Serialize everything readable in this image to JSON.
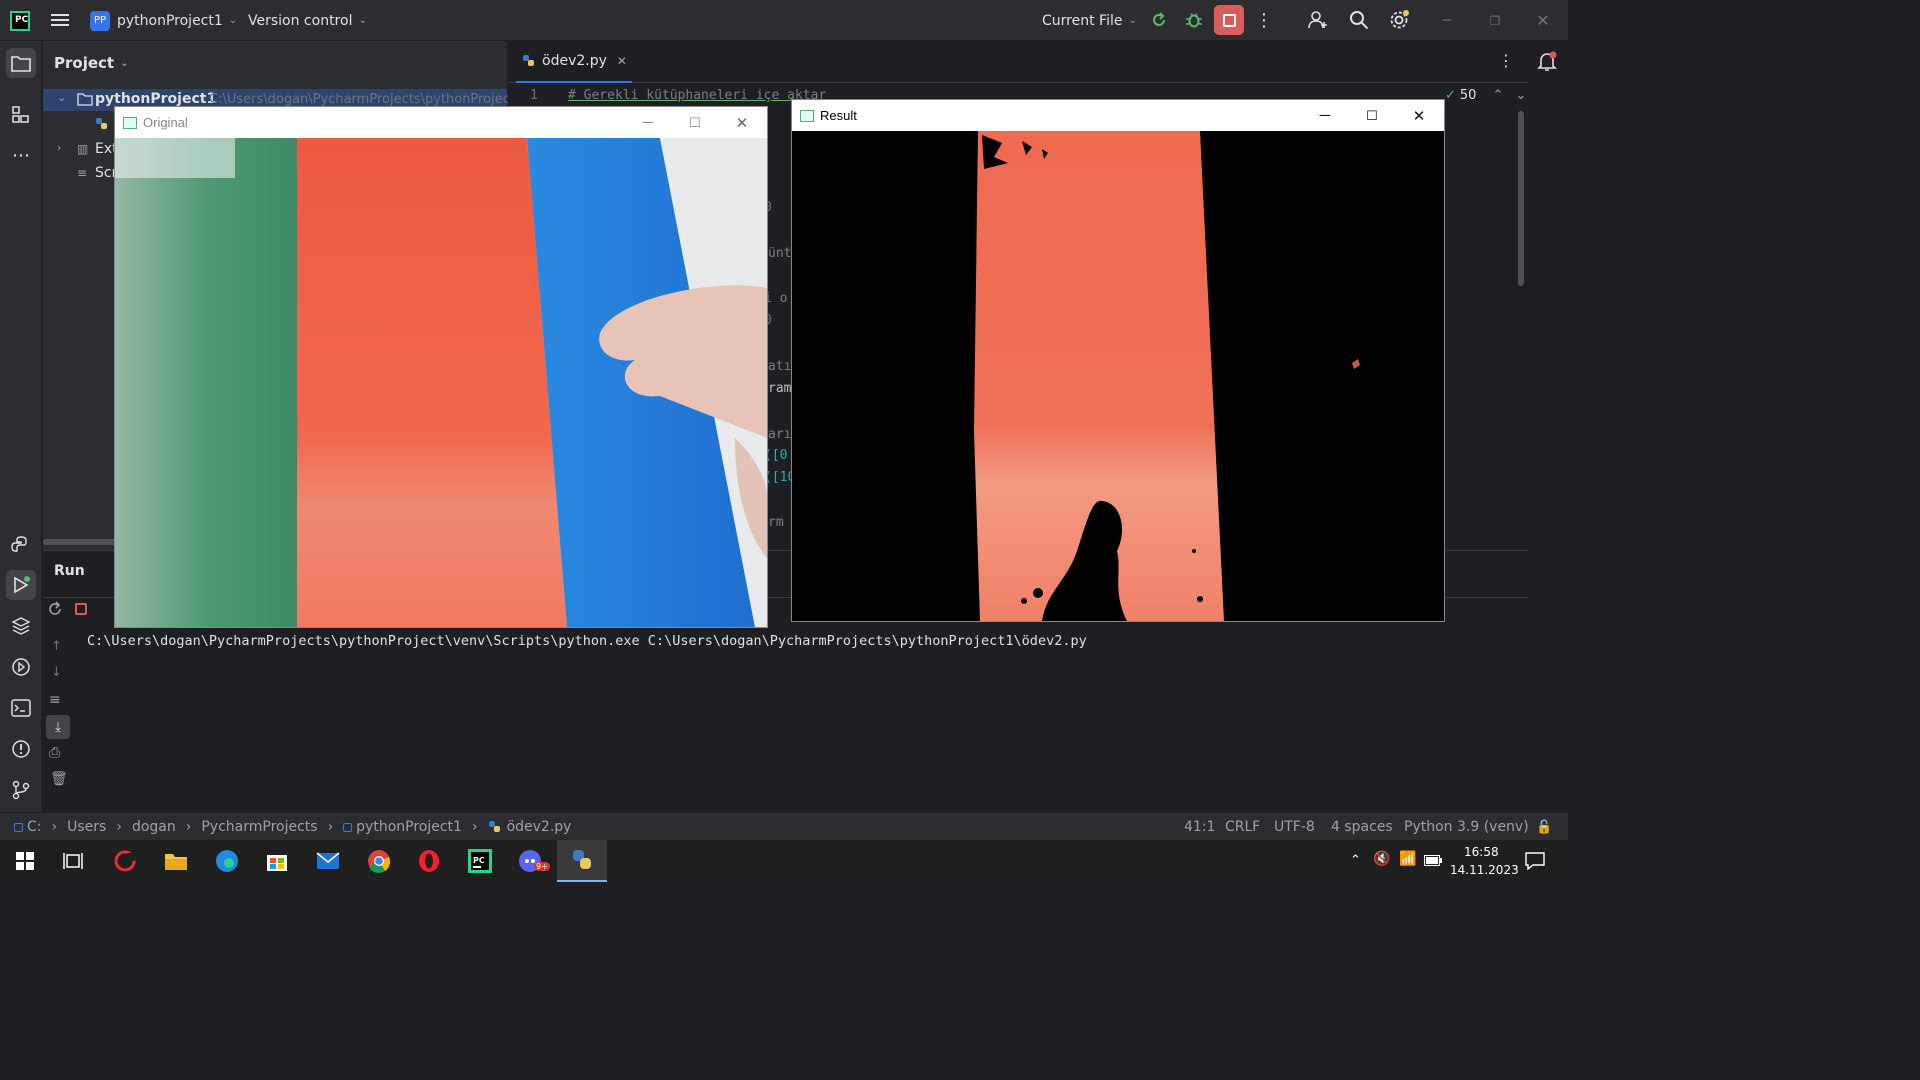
{
  "titlebar": {
    "project_badge": "PP",
    "project_name": "pythonProject1",
    "version_control": "Version control",
    "run_config": "Current File"
  },
  "project_panel": {
    "title": "Project",
    "root_name": "pythonProject1",
    "root_path": "C:\\Users\\dogan\\PycharmProjects\\pythonProjec",
    "external_libs": "Ext",
    "scratches": "Scr"
  },
  "editor": {
    "tab_name": "ödev2.py",
    "line_number": "1",
    "line1": "# Gerekli kütüphaneleri içe aktar",
    "inspection_count": "50",
    "fragments": [
      "0",
      "üntü",
      "i o",
      "0",
      "atı",
      "rame",
      "arı",
      "([0",
      "([10",
      "rm"
    ]
  },
  "windows": {
    "original_title": "Original",
    "result_title": "Result"
  },
  "run": {
    "tab_label": "Run",
    "command": "C:\\Users\\dogan\\PycharmProjects\\pythonProject\\venv\\Scripts\\python.exe C:\\Users\\dogan\\PycharmProjects\\pythonProject1\\ödev2.py"
  },
  "statusbar": {
    "breadcrumbs": [
      "C:",
      "Users",
      "dogan",
      "PycharmProjects",
      "pythonProject1",
      "ödev2.py"
    ],
    "position": "41:1",
    "line_ending": "CRLF",
    "encoding": "UTF-8",
    "indent": "4 spaces",
    "interpreter": "Python 3.9 (venv)"
  },
  "taskbar": {
    "time": "16:58",
    "date": "14.11.2023",
    "discord_badge": "9+"
  },
  "colors": {
    "accent": "#3574f0",
    "stop_red": "#db5c5c",
    "run_green": "#5fb865"
  }
}
